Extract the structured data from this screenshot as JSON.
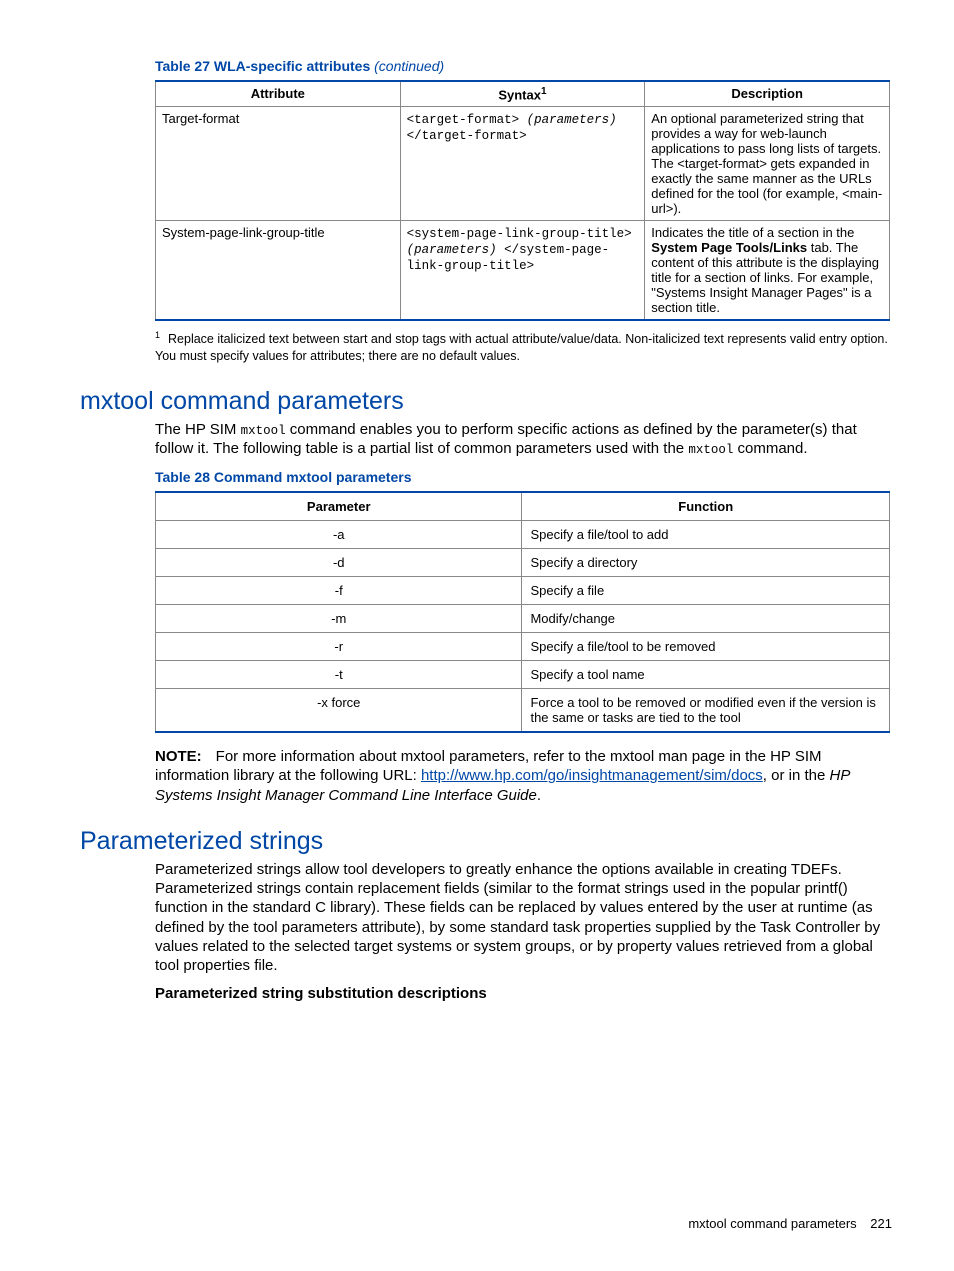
{
  "table27": {
    "title_prefix": "Table 27 WLA-specific attributes",
    "title_suffix": "(continued)",
    "headers": {
      "c1": "Attribute",
      "c2_pre": "Syntax",
      "c2_sup": "1",
      "c3": "Description"
    },
    "rows": [
      {
        "attribute": "Target-format",
        "syntax_open": "<target-format> ",
        "syntax_param": "(parameters)",
        "syntax_close": " </target-format>",
        "desc": "An optional parameterized string that provides a way for web-launch applications to pass long lists of targets. The <target-format> gets expanded in exactly the same manner as the URLs defined for the tool (for example, <main-url>)."
      },
      {
        "attribute": "System-page-link-group-title",
        "syntax_open": "<system-page-link-group-title> ",
        "syntax_param": "(parameters)",
        "syntax_close": " </system-page-link-group-title>",
        "desc_pre": "Indicates the title of a section in the ",
        "desc_bold": "System Page Tools/Links",
        "desc_post": " tab. The content of this attribute is the displaying title for a section of links. For example, \"Systems Insight Manager Pages\"  is a section title."
      }
    ],
    "footnote_num": "1",
    "footnote": "Replace italicized text between start and stop tags with actual attribute/value/data. Non-italicized text represents valid entry option. You must specify values for attributes; there are no default values."
  },
  "section1": {
    "heading": "mxtool command parameters",
    "para_pre": "The HP SIM ",
    "para_code1": "mxtool",
    "para_mid": " command enables you to perform specific actions as defined by the parameter(s) that follow it. The following table is a partial list of common parameters used with the ",
    "para_code2": "mxtool",
    "para_post": " command."
  },
  "table28": {
    "title": "Table 28 Command mxtool parameters",
    "headers": {
      "c1": "Parameter",
      "c2": "Function"
    },
    "rows": [
      {
        "p": "-a",
        "f": "Specify a file/tool to add"
      },
      {
        "p": "-d",
        "f": "Specify a directory"
      },
      {
        "p": "-f",
        "f": "Specify a file"
      },
      {
        "p": "-m",
        "f": "Modify/change"
      },
      {
        "p": "-r",
        "f": "Specify a file/tool to be removed"
      },
      {
        "p": "-t",
        "f": "Specify a tool name"
      },
      {
        "p": "-x force",
        "f": "Force a tool to be removed or modified even if the version is the same or tasks are tied to the tool"
      }
    ]
  },
  "note": {
    "label": "NOTE:",
    "text_pre": "For more information about mxtool parameters, refer to the mxtool man page in the HP SIM information library at the following URL: ",
    "link_text": "http://www.hp.com/go/insightmanagement/sim/docs",
    "text_mid": ", or in the ",
    "italic": "HP Systems Insight Manager Command Line Interface Guide",
    "text_post": "."
  },
  "section2": {
    "heading": "Parameterized strings",
    "para": "Parameterized strings allow tool developers to greatly enhance the options available in creating TDEFs. Parameterized strings contain replacement fields (similar to the format strings used in the popular printf() function in the standard C library). These fields can be replaced by values entered by the user at runtime (as defined by the tool parameters attribute), by some standard task properties supplied by the Task Controller by values related to the selected target systems or system groups, or by property values retrieved from a global tool properties file.",
    "subheading": "Parameterized string substitution descriptions"
  },
  "footer": {
    "text": "mxtool command parameters",
    "page": "221"
  }
}
